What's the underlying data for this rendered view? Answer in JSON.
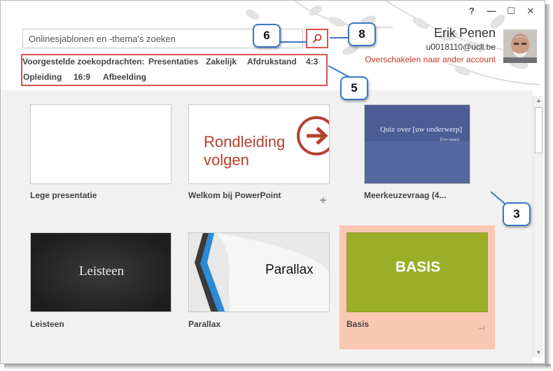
{
  "window": {
    "controls": [
      "?",
      "—",
      "☐",
      "✕"
    ]
  },
  "search": {
    "placeholder": "Onlinesjablonen en -thema's zoeken",
    "button_icon": "search-icon"
  },
  "suggestions": {
    "label": "Voorgestelde zoekopdrachten:",
    "items": [
      "Presentaties",
      "Zakelijk",
      "Afdrukstand",
      "4:3",
      "Opleiding",
      "16:9",
      "Afbeelding"
    ]
  },
  "account": {
    "name": "Erik Penen",
    "email": "u0018110@ucll.be",
    "switch_label": "Overschakelen naar ander account"
  },
  "callouts": [
    "6",
    "8",
    "5",
    "3"
  ],
  "templates": [
    {
      "label": "Lege presentatie",
      "thumb_text": ""
    },
    {
      "label": "Welkom bij PowerPoint",
      "thumb_text": "Rondleiding volgen",
      "thumb_line1": "Rondleiding",
      "thumb_line2": "volgen"
    },
    {
      "label": "Meerkeuzevraag (4...",
      "thumb_text": "Quiz over [uw onderwerp]",
      "thumb_sub": "[Uw naam]"
    },
    {
      "label": "Leisteen",
      "thumb_text": "Leisteen"
    },
    {
      "label": "Parallax",
      "thumb_text": "Parallax"
    },
    {
      "label": "Basis",
      "thumb_text": "BASIS"
    }
  ],
  "colors": {
    "accent_red": "#c0392b",
    "callout_blue": "#3a78c8",
    "quiz_blue": "#5468a0",
    "slate": "#2a2a2a",
    "basis_green": "#9aae2a",
    "highlight": "#f9c7b2"
  }
}
